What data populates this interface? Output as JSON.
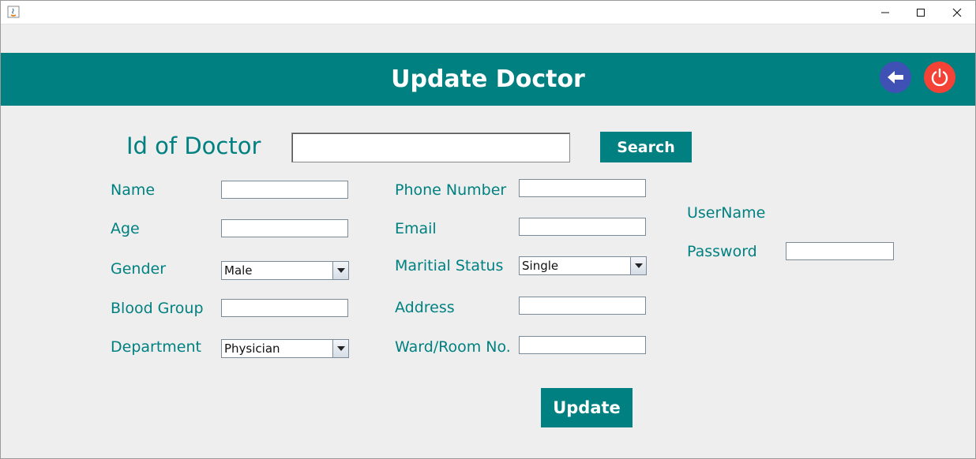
{
  "window": {
    "controls": {
      "minimize": "—",
      "maximize": "☐",
      "close": "✕"
    }
  },
  "header": {
    "title": "Update Doctor",
    "back_icon": "arrow-left-icon",
    "power_icon": "power-icon",
    "back_color": "#3f51b5",
    "power_color": "#f44336"
  },
  "search": {
    "label": "Id of Doctor",
    "value": "",
    "button": "Search"
  },
  "form": {
    "name": {
      "label": "Name",
      "value": ""
    },
    "age": {
      "label": "Age",
      "value": ""
    },
    "gender": {
      "label": "Gender",
      "selected": "Male"
    },
    "blood_group": {
      "label": "Blood Group",
      "value": ""
    },
    "department": {
      "label": "Department",
      "selected": "Physician"
    },
    "phone": {
      "label": "Phone Number",
      "value": ""
    },
    "email": {
      "label": "Email",
      "value": ""
    },
    "marital_status": {
      "label": "Maritial Status",
      "selected": "Single"
    },
    "address": {
      "label": "Address",
      "value": ""
    },
    "ward_room": {
      "label": "Ward/Room No.",
      "value": ""
    },
    "username": {
      "label": "UserName"
    },
    "password": {
      "label": "Password",
      "value": ""
    }
  },
  "actions": {
    "update": "Update"
  },
  "colors": {
    "accent": "#008080",
    "background": "#eeeeee"
  }
}
